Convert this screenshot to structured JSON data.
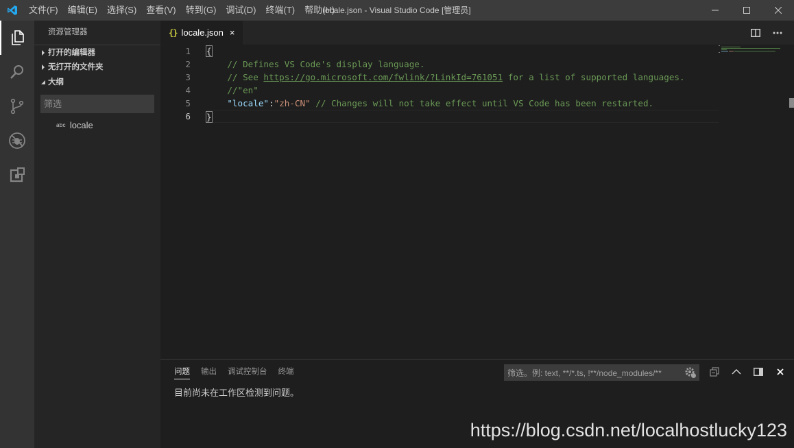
{
  "titlebar": {
    "menu": [
      "文件(F)",
      "编辑(E)",
      "选择(S)",
      "查看(V)",
      "转到(G)",
      "调试(D)",
      "终端(T)",
      "帮助(H)"
    ],
    "window_title": "locale.json - Visual Studio Code [管理员]",
    "controls": [
      "minimize-icon",
      "maximize-icon",
      "close-icon"
    ]
  },
  "activitybar": {
    "items": [
      "explorer-icon",
      "search-icon",
      "source-control-icon",
      "debug-icon",
      "extensions-icon"
    ]
  },
  "sidebar": {
    "title": "资源管理器",
    "sections": [
      {
        "label": "打开的编辑器",
        "expanded": false
      },
      {
        "label": "无打开的文件夹",
        "expanded": false
      },
      {
        "label": "大纲",
        "expanded": true
      }
    ],
    "filter_placeholder": "筛选",
    "outline_items": [
      {
        "kind": "abc",
        "label": "locale"
      }
    ]
  },
  "editor": {
    "tab": {
      "icon": "{}",
      "label": "locale.json",
      "close": "×"
    },
    "line_numbers": [
      "1",
      "2",
      "3",
      "4",
      "5",
      "6"
    ],
    "lines": {
      "l1": "{",
      "l2": "    // Defines VS Code's display language.",
      "l3_prefix": "    // See ",
      "l3_link": "https://go.microsoft.com/fwlink/?LinkId=761051",
      "l3_suffix": " for a list of supported languages.",
      "l4": "    //\"en\"",
      "l5_indent": "    ",
      "l5_key": "\"locale\"",
      "l5_colon": ":",
      "l5_value": "\"zh-CN\"",
      "l5_comment": " // Changes will not take effect until VS Code has been restarted.",
      "l6": "}"
    }
  },
  "panel": {
    "tabs": [
      "问题",
      "输出",
      "调试控制台",
      "终端"
    ],
    "active_tab": "问题",
    "filter_placeholder": "筛选。例: text, **/*.ts, !**/node_modules/**",
    "message": "目前尚未在工作区检测到问题。"
  },
  "watermark": "https://blog.csdn.net/localhostlucky123",
  "colors": {
    "titlebar": "#3c3c3c",
    "activitybar": "#333333",
    "sidebar": "#252526",
    "editor": "#1e1e1e",
    "comment": "#6a9955",
    "key": "#9cdcfe",
    "string": "#ce9178",
    "json_icon": "#cbcb41",
    "vscode_blue": "#23a9f2"
  }
}
